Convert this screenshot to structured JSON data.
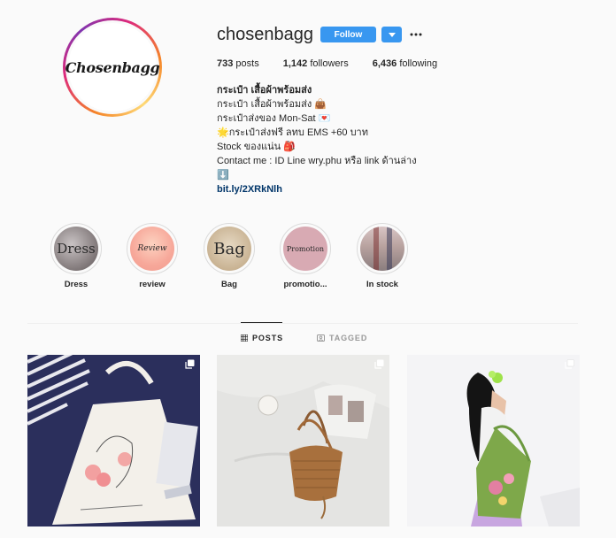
{
  "profile": {
    "avatar_text": "Chosenbagg",
    "username": "chosenbagg",
    "follow_label": "Follow",
    "more_icon": "more-icon",
    "stats": {
      "posts_count": "733",
      "posts_label": "posts",
      "followers_count": "1,142",
      "followers_label": "followers",
      "following_count": "6,436",
      "following_label": "following"
    },
    "bio": {
      "name": "กระเป๋า เสื้อผ้าพร้อมส่ง",
      "line1": "กระเป๋า เสื้อผ้าพร้อมส่ง 👜",
      "line2": "กระเป๋าส่งของ Mon-Sat 💌",
      "line3": "🌟กระเป๋าส่งฟรี ลทบ EMS +60 บาท",
      "line4": "Stock ของแน่น 🎒",
      "line5": "Contact me : ID Line wry.phu หรือ link ด้านล่าง",
      "line6": "⬇️",
      "link": "bit.ly/2XRkNlh"
    }
  },
  "highlights": [
    {
      "label": "Dress",
      "cover_text": "Dress"
    },
    {
      "label": "review",
      "cover_text": "Review"
    },
    {
      "label": "Bag",
      "cover_text": "Bag"
    },
    {
      "label": "promotio...",
      "cover_text": "Promotion"
    },
    {
      "label": "In stock",
      "cover_text": ""
    }
  ],
  "tabs": {
    "posts": "POSTS",
    "tagged": "TAGGED"
  },
  "posts_icons": [
    "multiple-images-icon",
    "multiple-images-icon",
    "multiple-images-icon"
  ],
  "colors": {
    "follow_blue": "#3897f0",
    "link": "#003569",
    "text": "#262626",
    "muted": "#999999",
    "background": "#fafafa"
  }
}
